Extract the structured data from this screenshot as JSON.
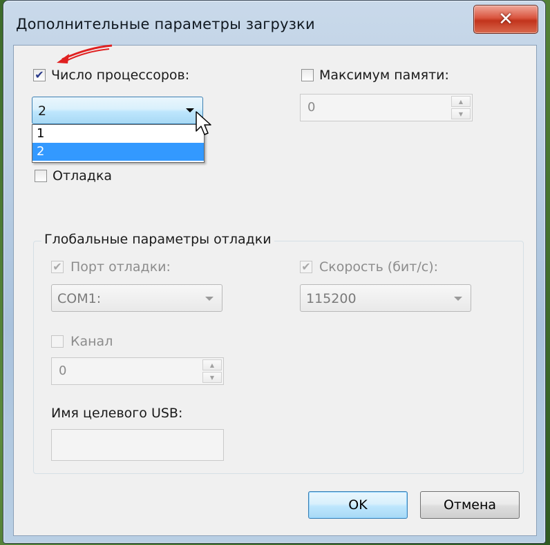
{
  "window": {
    "title": "Дополнительные параметры загрузки"
  },
  "processors": {
    "label": "Число процессоров:",
    "checked": true,
    "selected": "2",
    "options": [
      "1",
      "2"
    ]
  },
  "max_memory": {
    "label": "Максимум памяти:",
    "checked": false,
    "value": "0"
  },
  "debug": {
    "label": "Отладка",
    "checked": false
  },
  "global_debug": {
    "title": "Глобальные параметры отладки",
    "port_label": "Порт отладки:",
    "port_value": "COM1:",
    "speed_label": "Скорость (бит/с):",
    "speed_value": "115200",
    "channel_label": "Канал",
    "channel_value": "0",
    "usb_label": "Имя целевого USB:",
    "usb_value": ""
  },
  "buttons": {
    "ok": "OK",
    "cancel": "Отмена"
  },
  "icons": {
    "close": "close-icon",
    "check": "checkmark-icon",
    "dropdown": "chevron-down-icon",
    "spin_up": "spin-up-icon",
    "spin_down": "spin-down-icon",
    "cursor": "mouse-pointer-icon",
    "annotation": "red-arrow-annotation"
  },
  "colors": {
    "selection": "#3399ff",
    "close_button": "#c2341c",
    "annotation_arrow": "#e02020"
  }
}
